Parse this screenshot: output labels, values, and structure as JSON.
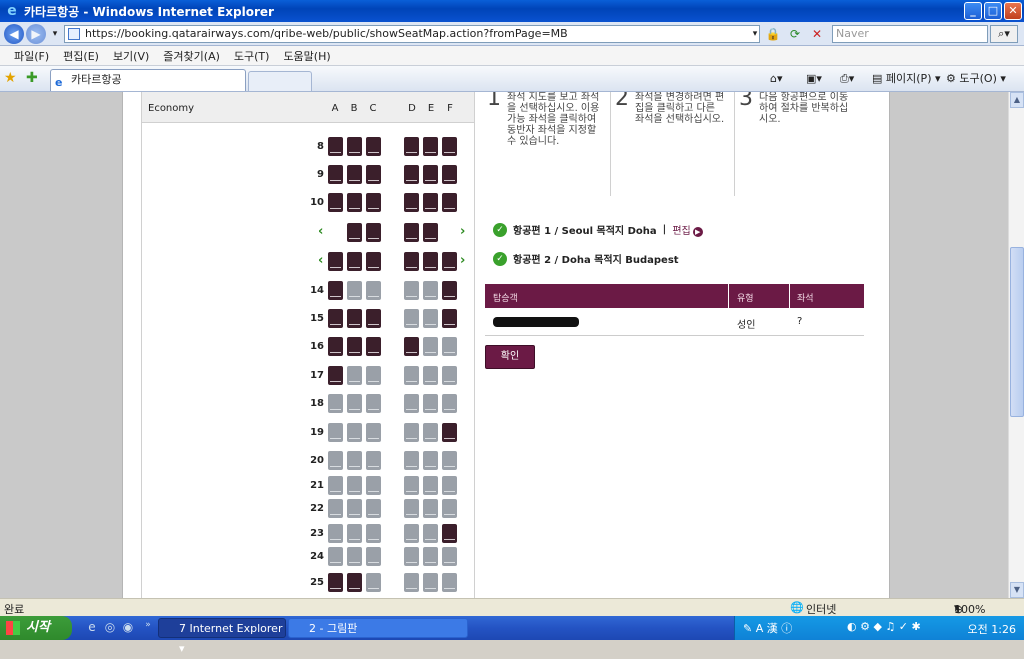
{
  "window": {
    "title": "카타르항공 - Windows Internet Explorer"
  },
  "address": {
    "url": "https://booking.qatarairways.com/qribe-web/public/showSeatMap.action?fromPage=MB",
    "search_placeholder": "Naver"
  },
  "menu": [
    "파일(F)",
    "편집(E)",
    "보기(V)",
    "즐겨찾기(A)",
    "도구(T)",
    "도움말(H)"
  ],
  "tab": {
    "active_title": "카타르항공"
  },
  "commands": {
    "page": "페이지(P)",
    "tools": "도구(O)"
  },
  "seatmap": {
    "cabin": "Economy",
    "columns": [
      "A",
      "B",
      "C",
      "D",
      "E",
      "F"
    ],
    "rows": [
      {
        "num": "8",
        "seats": "OOO-OOO"
      },
      {
        "num": "9",
        "seats": "OOO-OOO"
      },
      {
        "num": "10",
        "seats": "OOO-OOO"
      },
      {
        "num": "",
        "seats": "_OO-OO_",
        "exit": true
      },
      {
        "num": "",
        "seats": "OOO-OOO",
        "exit": true
      },
      {
        "num": "14",
        "seats": "OFF-FFO"
      },
      {
        "num": "15",
        "seats": "OOO-FFO"
      },
      {
        "num": "16",
        "seats": "OOO-OFF"
      },
      {
        "num": "17",
        "seats": "OFF-FFF"
      },
      {
        "num": "18",
        "seats": "FFF-FFF"
      },
      {
        "num": "19",
        "seats": "FFF-FFO"
      },
      {
        "num": "20",
        "seats": "FFF-FFF"
      },
      {
        "num": "21",
        "seats": "FFF-FFF"
      },
      {
        "num": "22",
        "seats": "FFF-FFF"
      },
      {
        "num": "23",
        "seats": "FFF-FFO"
      },
      {
        "num": "24",
        "seats": "FFF-FFF"
      },
      {
        "num": "25",
        "seats": "OOF-FFF"
      }
    ]
  },
  "steps": [
    {
      "num": "1",
      "text": "좌석 지도를 보고 좌석을 선택하십시오. 이용 가능 좌석을 클릭하여 동반자 좌석을 지정할 수 있습니다."
    },
    {
      "num": "2",
      "text": "좌석을 변경하려면 편집을 클릭하고 다른 좌석을 선택하십시오."
    },
    {
      "num": "3",
      "text": "다음 항공편으로 이동하여 절차를 반복하십시오."
    }
  ],
  "flights": [
    {
      "label": "항공편 1 / Seoul 목적지 Doha",
      "edit": "편집"
    },
    {
      "label": "항공편 2 / Doha 목적지 Budapest"
    }
  ],
  "passenger_table": {
    "headers": [
      "탑승객",
      "유형",
      "좌석"
    ],
    "row": {
      "type": "성인",
      "seat": "?"
    }
  },
  "confirm_label": "확인",
  "status": {
    "left": "완료",
    "zone": "인터넷",
    "zoom": "100%"
  },
  "taskbar": {
    "start": "시작",
    "ie_task": "7 Internet Explorer",
    "paint_task": "2 - 그림판",
    "clock": "오전 1:26"
  }
}
